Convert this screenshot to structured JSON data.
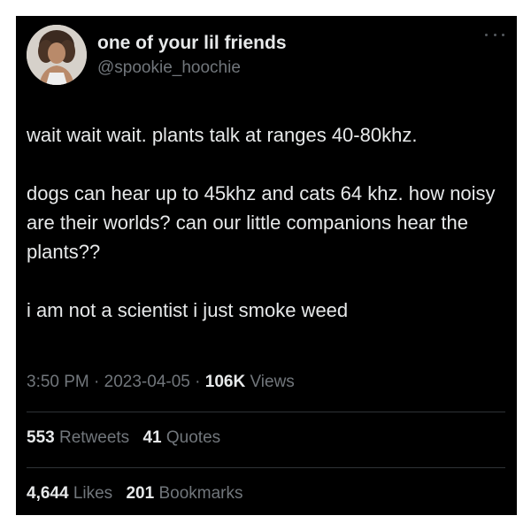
{
  "author": {
    "display_name": "one of your lil friends",
    "handle": "@spookie_hoochie",
    "avatar_icon": "profile-photo"
  },
  "tweet": {
    "paragraphs": [
      "wait wait wait. plants talk at ranges 40-80khz.",
      "dogs can hear up to 45khz and cats 64 khz. how noisy are their worlds? can our little companions hear the plants??",
      "i am not a scientist i just smoke weed"
    ]
  },
  "meta": {
    "time": "3:50 PM",
    "separator": " · ",
    "date": "2023-04-05",
    "views_count": "106K",
    "views_label": " Views"
  },
  "engagement": {
    "retweets_count": "553",
    "retweets_label": " Retweets",
    "quotes_count": "41",
    "quotes_label": " Quotes",
    "likes_count": "4,644",
    "likes_label": " Likes",
    "bookmarks_count": "201",
    "bookmarks_label": " Bookmarks"
  },
  "colors": {
    "background": "#000000",
    "primary_text": "#e7e9ea",
    "secondary_text": "#71767b",
    "divider": "#2f3336"
  }
}
